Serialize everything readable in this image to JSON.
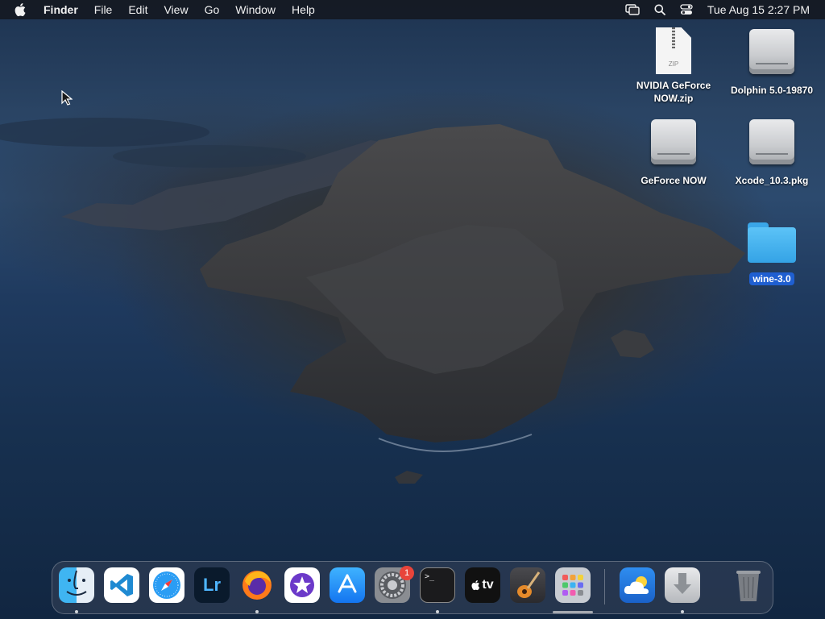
{
  "menubar": {
    "app_name": "Finder",
    "menus": [
      "File",
      "Edit",
      "View",
      "Go",
      "Window",
      "Help"
    ],
    "clock": "Tue Aug 15  2:27 PM",
    "status_icons": [
      "screen-mirroring-icon",
      "spotlight-search-icon",
      "control-center-icon"
    ]
  },
  "desktop": {
    "icons": [
      {
        "label": "NVIDIA GeForce NOW.zip",
        "kind": "zip-archive"
      },
      {
        "label": "Dolphin 5.0-19870",
        "kind": "disk-image"
      },
      {
        "label": "GeForce NOW",
        "kind": "disk-image"
      },
      {
        "label": "Xcode_10.3.pkg",
        "kind": "disk-image"
      },
      {
        "label": "wine-3.0",
        "kind": "folder",
        "selected": true
      }
    ]
  },
  "dock": {
    "apps": [
      {
        "name": "Finder",
        "icon": "finder-icon",
        "running": true
      },
      {
        "name": "Visual Studio Code",
        "icon": "vscode-icon",
        "running": false
      },
      {
        "name": "Safari",
        "icon": "safari-icon",
        "running": false
      },
      {
        "name": "Lightroom",
        "icon": "lightroom-icon",
        "icon_text": "Lr",
        "running": false
      },
      {
        "name": "Firefox",
        "icon": "firefox-icon",
        "running": true
      },
      {
        "name": "iMovie",
        "icon": "imovie-icon",
        "running": false
      },
      {
        "name": "App Store",
        "icon": "app-store-icon",
        "running": false
      },
      {
        "name": "System Preferences",
        "icon": "system-preferences-icon",
        "badge": "1",
        "running": false
      },
      {
        "name": "Terminal",
        "icon": "terminal-icon",
        "icon_text": ">_",
        "running": true
      },
      {
        "name": "Apple TV",
        "icon": "apple-tv-icon",
        "icon_text": "tv",
        "running": false
      },
      {
        "name": "GarageBand",
        "icon": "garageband-icon",
        "running": false
      },
      {
        "name": "Launchpad",
        "icon": "launchpad-icon",
        "running": false
      },
      {
        "name": "Weather",
        "icon": "weather-icon",
        "running": false
      },
      {
        "name": "Downloads",
        "icon": "downloads-stack-icon",
        "running": true
      },
      {
        "name": "Trash",
        "icon": "trash-icon",
        "running": false
      }
    ]
  },
  "colors": {
    "menubar_bg": "#14161c",
    "selection_blue": "#1f5fd1",
    "folder_blue": "#34a3e6",
    "badge_red": "#e8443a"
  }
}
